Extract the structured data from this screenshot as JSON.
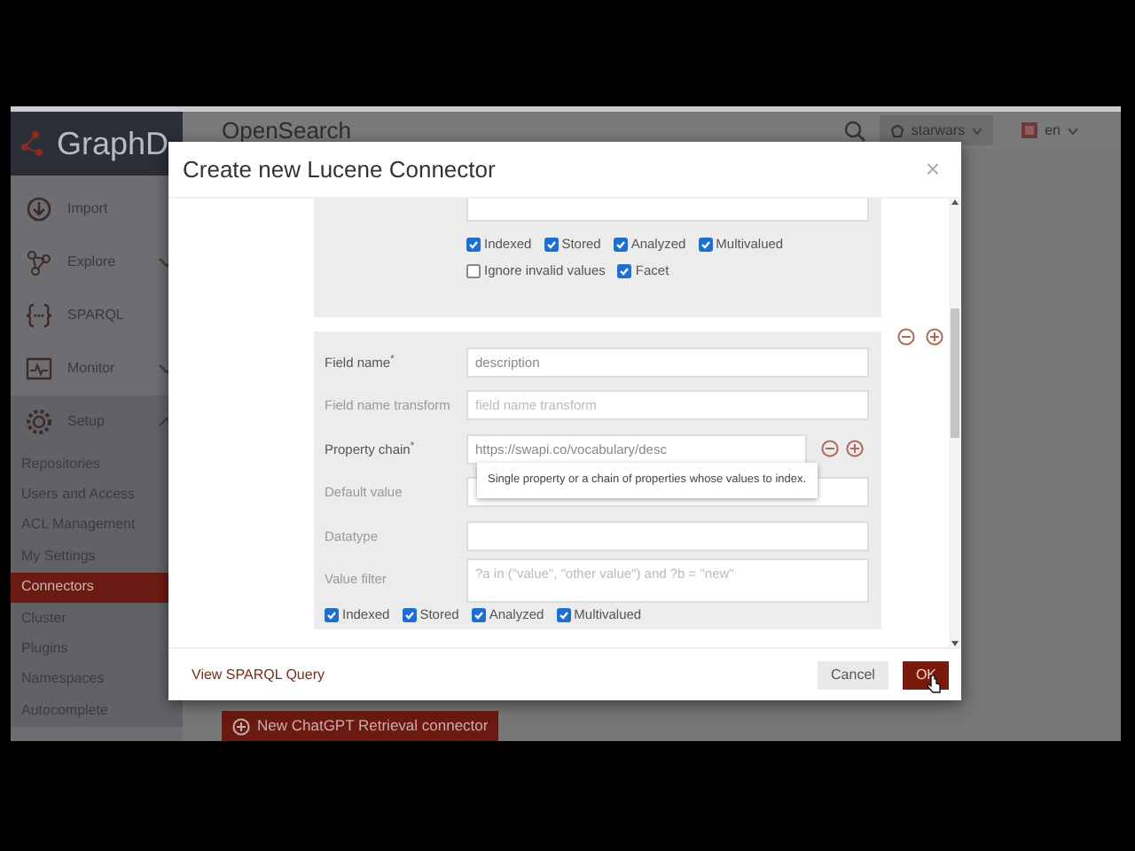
{
  "sidebar": {
    "logo": "GraphD",
    "items": [
      {
        "label": "Import",
        "kind": "link"
      },
      {
        "label": "Explore",
        "kind": "group",
        "expanded": false
      },
      {
        "label": "SPARQL",
        "kind": "link"
      },
      {
        "label": "Monitor",
        "kind": "group",
        "expanded": false
      },
      {
        "label": "Setup",
        "kind": "group",
        "expanded": true
      }
    ],
    "subitems": [
      {
        "label": "Repositories",
        "selected": false
      },
      {
        "label": "Users and Access",
        "selected": false
      },
      {
        "label": "ACL Management",
        "selected": false
      },
      {
        "label": "My Settings",
        "selected": false
      },
      {
        "label": "Connectors",
        "selected": true
      },
      {
        "label": "Cluster",
        "selected": false
      },
      {
        "label": "Plugins",
        "selected": false
      },
      {
        "label": "Namespaces",
        "selected": false
      },
      {
        "label": "Autocomplete",
        "selected": false
      }
    ]
  },
  "header": {
    "title": "OpenSearch",
    "repository": "starwars",
    "language": "en"
  },
  "page_button": "New ChatGPT Retrieval connector",
  "modal": {
    "title": "Create new Lucene Connector",
    "close": "×",
    "panels": [
      {
        "option_rows": [
          [
            {
              "label": "Indexed",
              "checked": true
            },
            {
              "label": "Stored",
              "checked": true
            },
            {
              "label": "Analyzed",
              "checked": true
            },
            {
              "label": "Multivalued",
              "checked": true
            }
          ],
          [
            {
              "label": "Ignore invalid values",
              "checked": false
            },
            {
              "label": "Facet",
              "checked": true
            }
          ]
        ]
      },
      {
        "fields": [
          {
            "label": "Field name$^{*}$",
            "required": true,
            "kind": "input",
            "value": "description"
          },
          {
            "label": "Field name transform",
            "required": false,
            "kind": "input",
            "placeholder": "field name transform"
          },
          {
            "label": "Property chain$^{*}$",
            "required": true,
            "kind": "chain",
            "value": "https://swapi.co/vocabulary/desc",
            "tooltip": "Single property or a chain of properties whose values to index."
          },
          {
            "label": "Default value",
            "required": false,
            "kind": "input"
          },
          {
            "label": "Datatype",
            "required": false,
            "kind": "input"
          },
          {
            "label": "Value filter",
            "required": false,
            "kind": "textarea",
            "placeholder": "?a in (\"value\", \"other value\") and ?b = \"new\""
          }
        ],
        "option_rows": [
          [
            {
              "label": "Indexed",
              "checked": true
            },
            {
              "label": "Stored",
              "checked": true
            },
            {
              "label": "Analyzed",
              "checked": true
            },
            {
              "label": "Multivalued",
              "checked": true
            }
          ]
        ]
      }
    ],
    "footer_link": "View SPARQL Query",
    "buttons": [
      {
        "label": "Cancel",
        "kind": "secondary"
      },
      {
        "label": "OK",
        "kind": "primary"
      }
    ]
  }
}
